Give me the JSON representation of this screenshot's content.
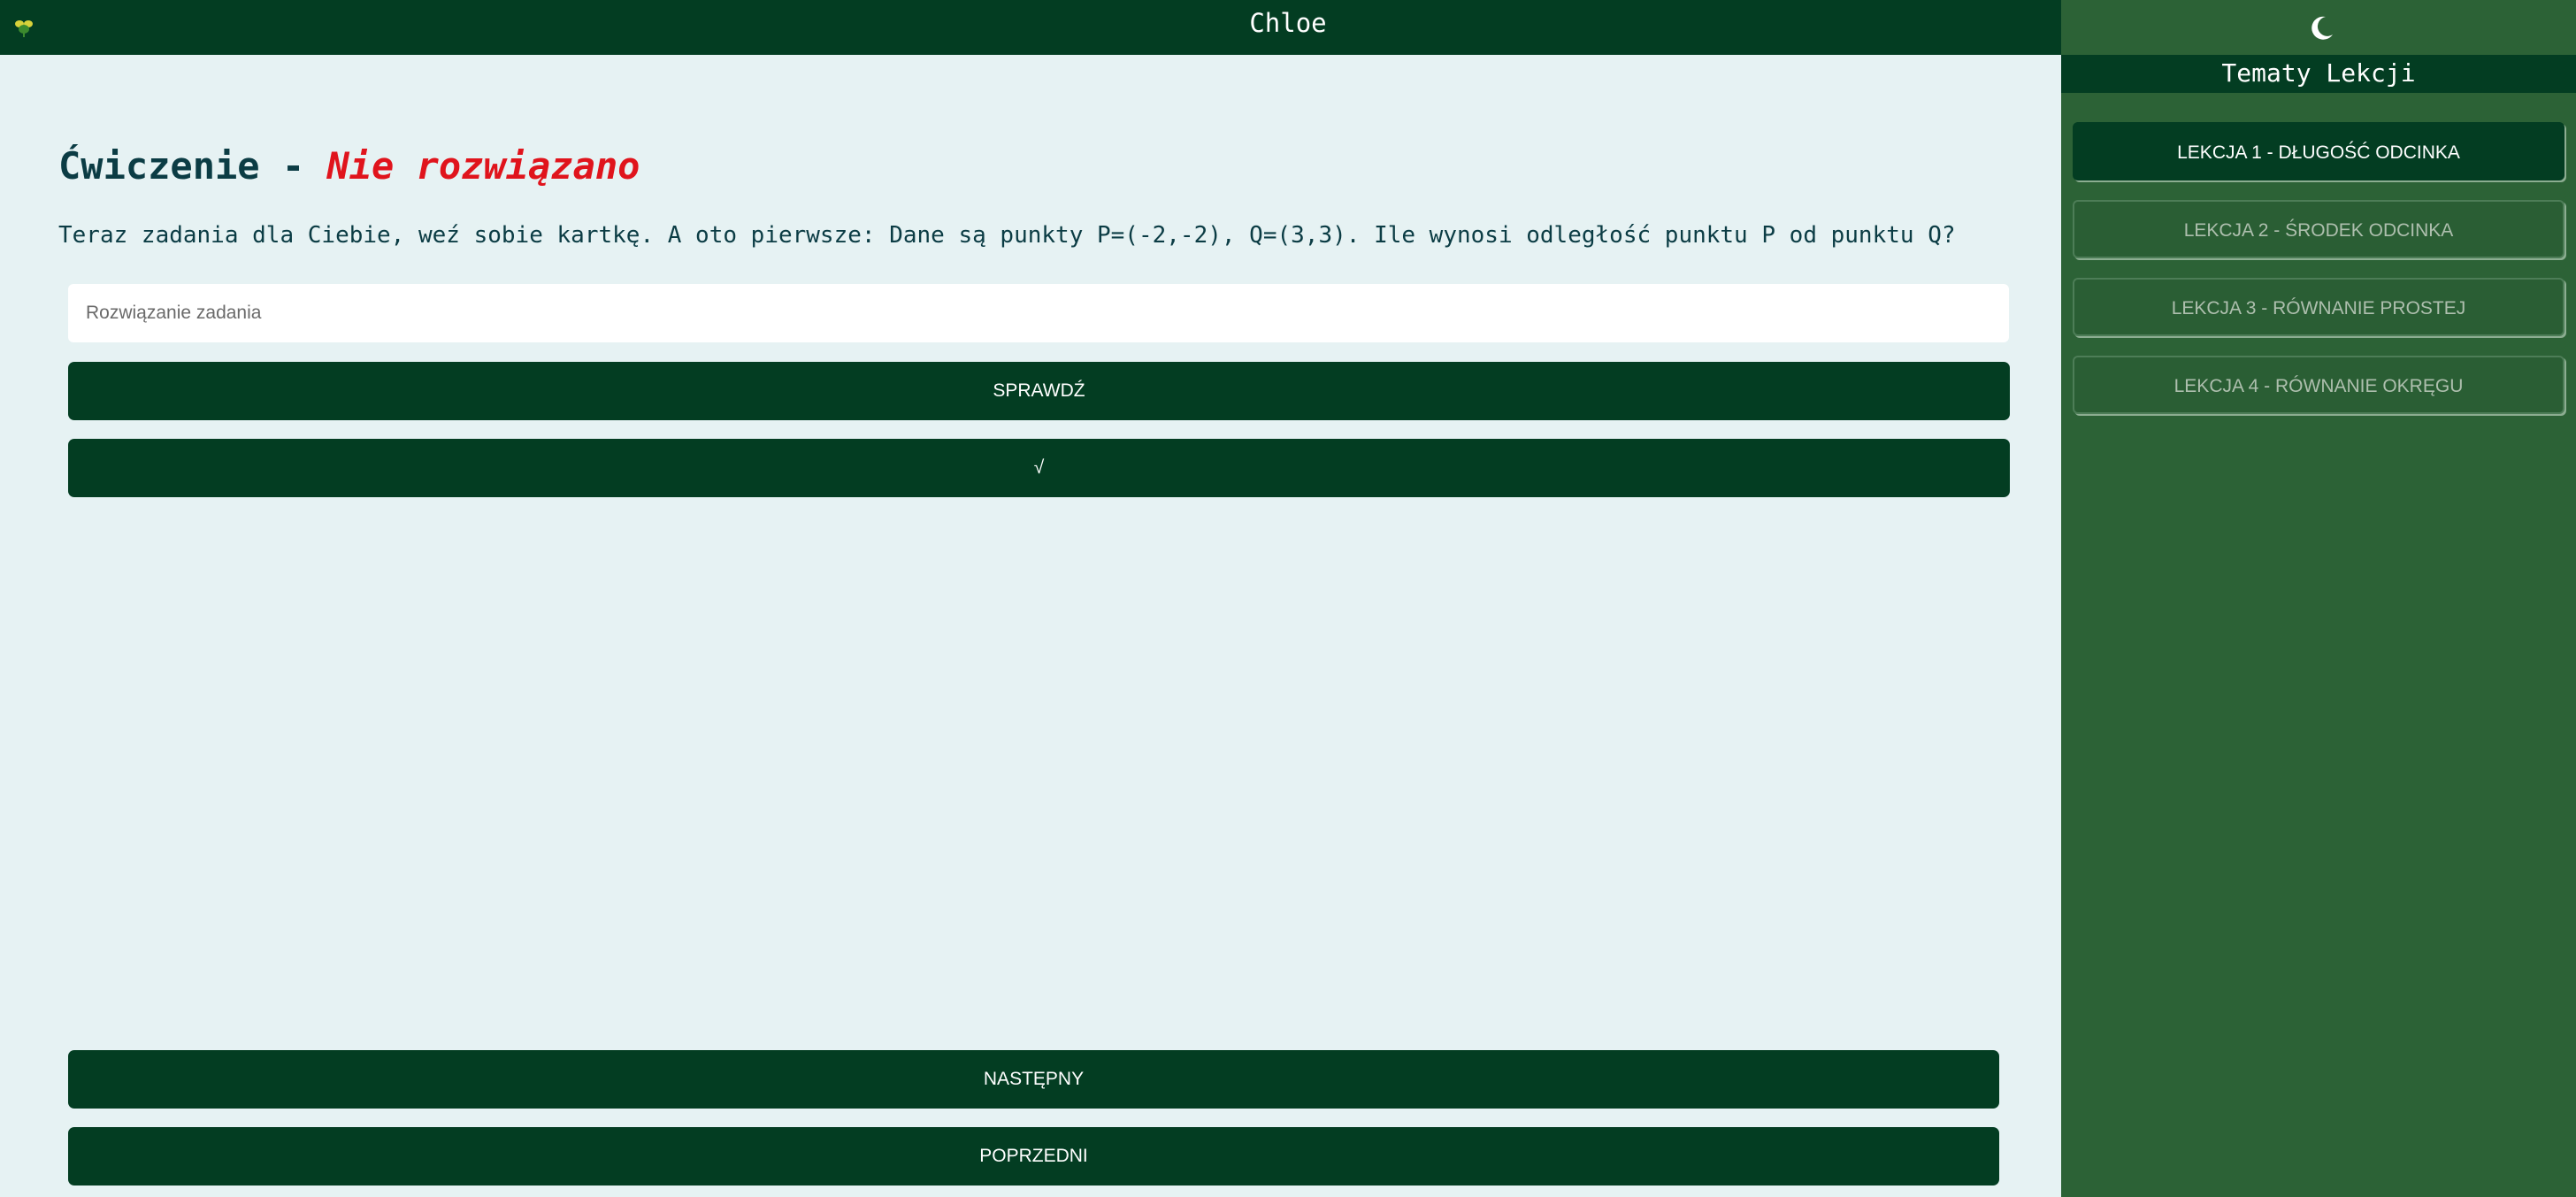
{
  "header": {
    "title": "Chloe",
    "logo_icon": "leaf-logo-icon",
    "theme_icon": "moon-icon"
  },
  "sidebar": {
    "title": "Tematy Lekcji",
    "lessons": [
      {
        "label": "LEKCJA 1 - DŁUGOŚĆ ODCINKA",
        "active": true
      },
      {
        "label": "LEKCJA 2 - ŚRODEK ODCINKA",
        "active": false
      },
      {
        "label": "LEKCJA 3 - RÓWNANIE PROSTEJ",
        "active": false
      },
      {
        "label": "LEKCJA 4 - RÓWNANIE OKRĘGU",
        "active": false
      }
    ]
  },
  "exercise": {
    "title_prefix": "Ćwiczenie - ",
    "status": "Nie rozwiązano",
    "prompt": "Teraz zadania dla Ciebie, weź sobie kartkę. A oto pierwsze: Dane są punkty P=(-2,-2), Q=(3,3). Ile wynosi odległość punktu P od punktu Q?",
    "answer_placeholder": "Rozwiązanie zadania",
    "answer_value": "",
    "check_label": "SPRAWDŹ",
    "sqrt_label": "√"
  },
  "navigation": {
    "next_label": "NASTĘPNY",
    "prev_label": "POPRZEDNI"
  },
  "colors": {
    "dark_green": "#033d22",
    "sidebar_green": "#2c6236",
    "background": "#e6f2f3",
    "status_red": "#e0141c",
    "text_teal": "#0b3c44"
  }
}
